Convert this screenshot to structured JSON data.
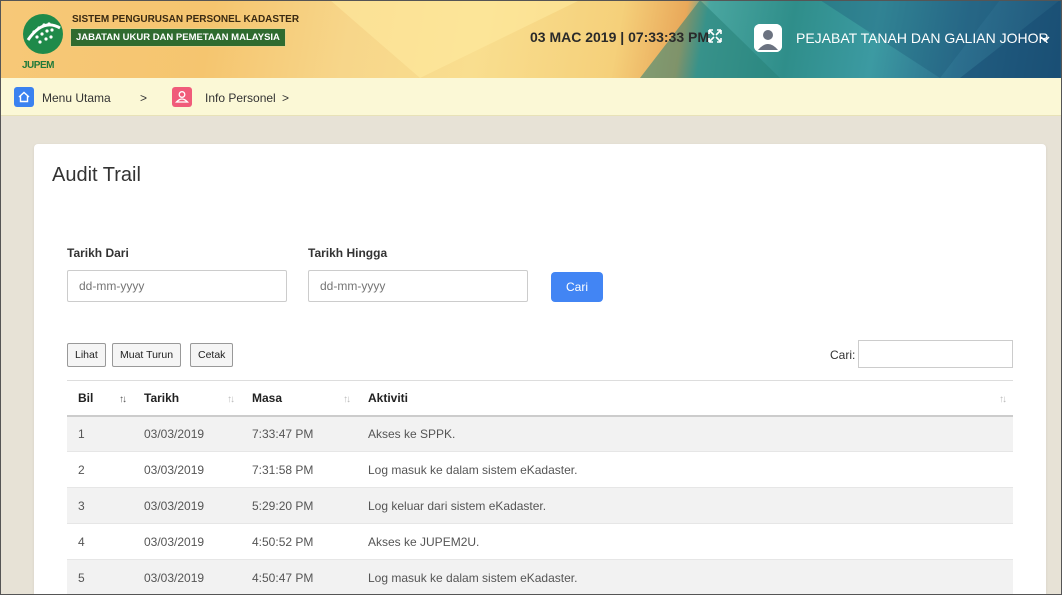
{
  "header": {
    "logo_text": "JUPEM",
    "system_title": "SISTEM PENGURUSAN PERSONEL KADASTER",
    "department": "JABATAN UKUR DAN PEMETAAN MALAYSIA",
    "datetime": "03 MAC 2019 | 07:33:33 PM",
    "office": "PEJABAT TANAH DAN GALIAN JOHOR",
    "icons": [
      "expand-icon",
      "user-avatar-icon",
      "chevron-down-icon"
    ]
  },
  "breadcrumb": {
    "items": [
      {
        "label": "Menu Utama",
        "icon": "home-icon",
        "color": "#3a82f0"
      },
      {
        "label": "Info Personel",
        "icon": "user-icon",
        "color": "#f05b7a"
      }
    ],
    "separator": ">"
  },
  "page": {
    "title": "Audit Trail",
    "filters": {
      "from_label": "Tarikh Dari",
      "from_placeholder": "dd-mm-yyyy",
      "to_label": "Tarikh Hingga",
      "to_placeholder": "dd-mm-yyyy",
      "search_button": "Cari"
    },
    "toolbar": {
      "view": "Lihat",
      "download": "Muat Turun",
      "print": "Cetak",
      "search_label": "Cari:"
    }
  },
  "table": {
    "columns": [
      "Bil",
      "Tarikh",
      "Masa",
      "Aktiviti"
    ],
    "rows": [
      [
        "1",
        "03/03/2019",
        "7:33:47 PM",
        "Akses ke SPPK."
      ],
      [
        "2",
        "03/03/2019",
        "7:31:58 PM",
        "Log masuk ke dalam sistem eKadaster."
      ],
      [
        "3",
        "03/03/2019",
        "5:29:20 PM",
        "Log keluar dari sistem eKadaster."
      ],
      [
        "4",
        "03/03/2019",
        "4:50:52 PM",
        "Akses ke JUPEM2U."
      ],
      [
        "5",
        "03/03/2019",
        "4:50:47 PM",
        "Log masuk ke dalam sistem eKadaster."
      ]
    ]
  },
  "colors": {
    "primary_button": "#4285f4",
    "home_icon_bg": "#3a82f0",
    "user_icon_bg": "#f05b7a",
    "breadcrumb_bg": "#fbf8d6",
    "department_badge_bg": "#2f6b2f"
  }
}
